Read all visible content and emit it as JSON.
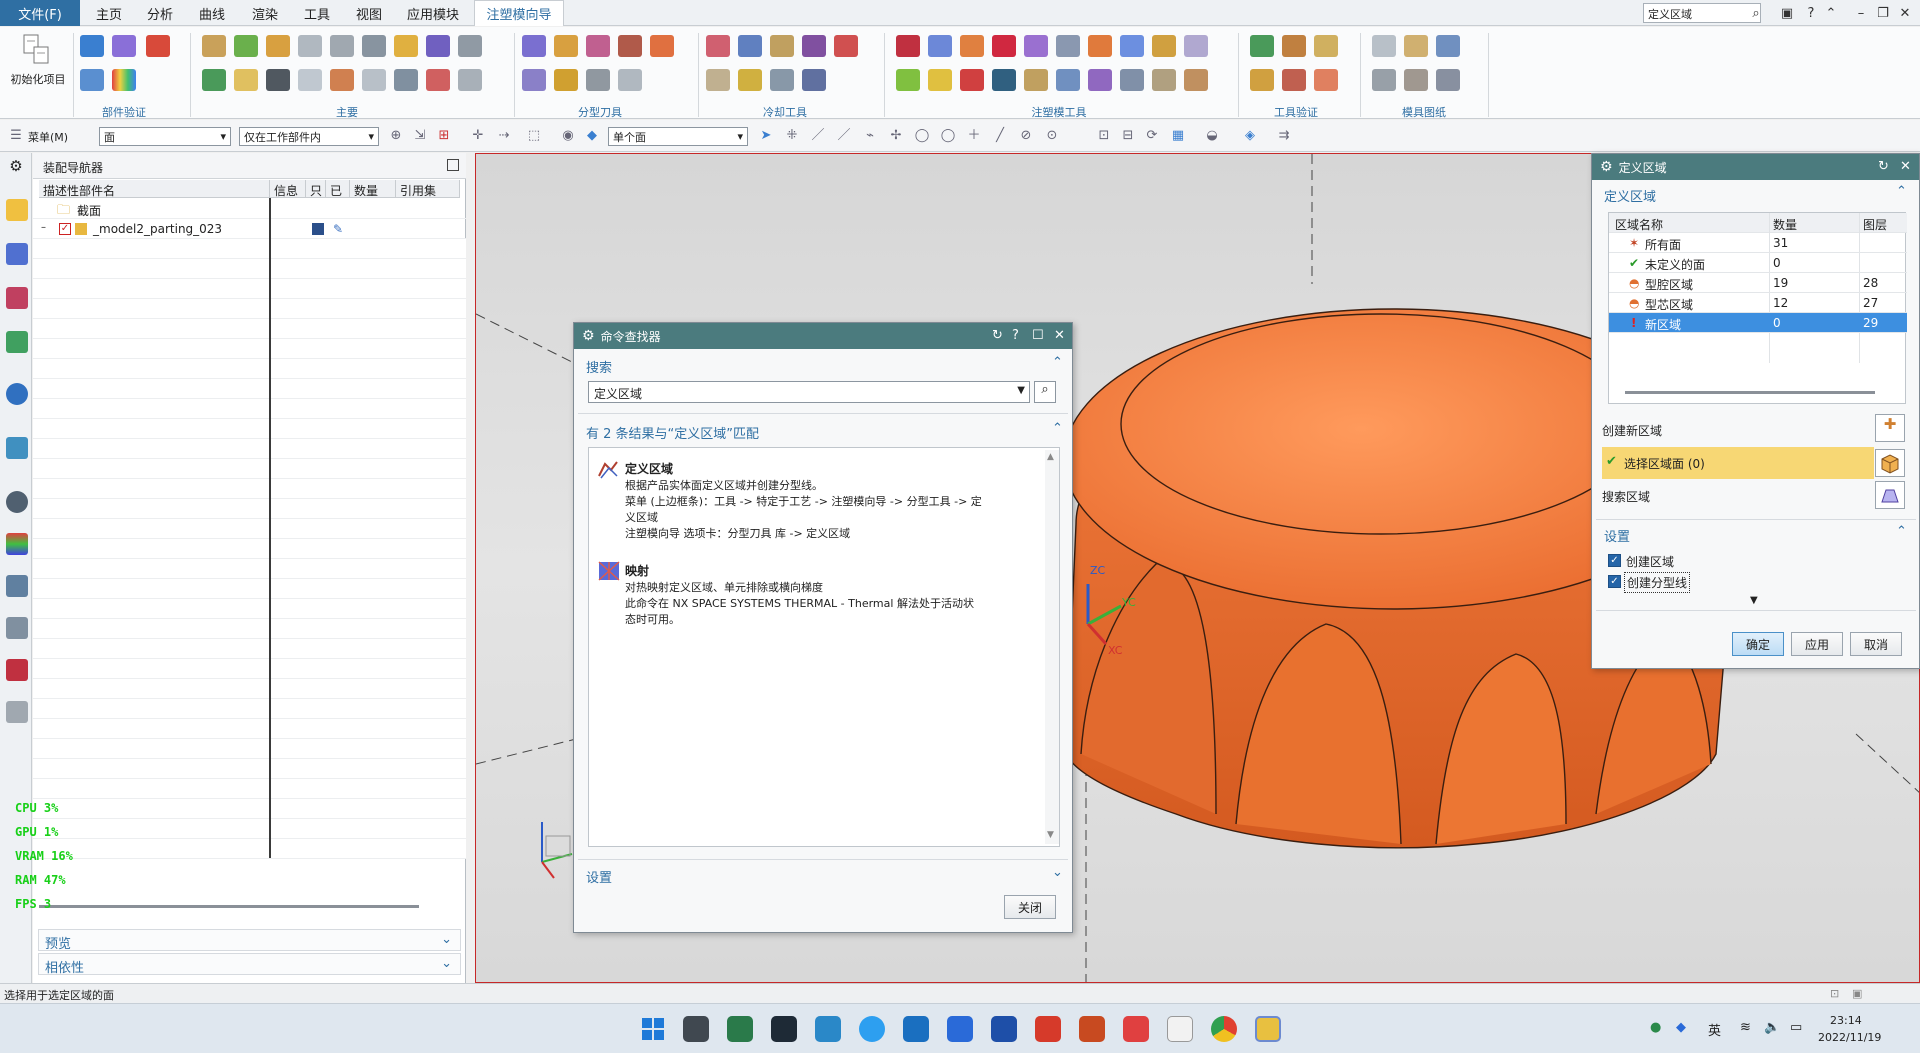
{
  "menubar": {
    "file": "文件(F)",
    "tabs": [
      "主页",
      "分析",
      "曲线",
      "渲染",
      "工具",
      "视图",
      "应用模块",
      "注塑模向导"
    ],
    "active_tab": "注塑模向导",
    "search_value": "定义区域"
  },
  "ribbon": {
    "init_label": "初始化项目",
    "groups": [
      "部件验证",
      "主要",
      "分型刀具",
      "冷却工具",
      "注塑模工具",
      "工具验证",
      "模具图纸"
    ]
  },
  "toolbar2": {
    "menu_label": "菜单(M)",
    "filter_type": "面",
    "filter_scope": "仅在工作部件内",
    "select_mode": "单个面"
  },
  "navigator": {
    "title": "装配导航器",
    "columns": [
      "描述性部件名",
      "信息",
      "只",
      "已",
      "数量",
      "引用集"
    ],
    "rows": [
      {
        "name": "截面"
      },
      {
        "name": "_model2_parting_023"
      }
    ],
    "sections": [
      "预览",
      "相依性"
    ]
  },
  "perf": {
    "cpu": "CPU   3%",
    "gpu": "GPU   1%",
    "vram": "VRAM  16%",
    "ram": "RAM   47%",
    "fps": "FPS    3"
  },
  "command_finder": {
    "title": "命令查找器",
    "search_section": "搜索",
    "search_value": "定义区域",
    "results_header": "有 2 条结果与“定义区域”匹配",
    "results": [
      {
        "title": "定义区域",
        "line1": "根据产品实体面定义区域并创建分型线。",
        "line2": "菜单 (上边框条)：工具 -> 特定于工艺 -> 注塑模向导 -> 分型工具 -> 定",
        "line3": "义区域",
        "line4": "注塑模向导 选项卡：分型刀具 库 -> 定义区域"
      },
      {
        "title": "映射",
        "line1": "对热映射定义区域、单元排除或横向梯度",
        "line2": "此命令在 NX SPACE SYSTEMS THERMAL - Thermal 解法处于活动状",
        "line3": "态时可用。"
      }
    ],
    "settings_section": "设置",
    "close_label": "关闭"
  },
  "define_region": {
    "title": "定义区域",
    "section_title": "定义区域",
    "columns": [
      "区域名称",
      "数量",
      "图层"
    ],
    "rows": [
      {
        "name": "所有面",
        "count": "31",
        "layer": ""
      },
      {
        "name": "未定义的面",
        "count": "0",
        "layer": ""
      },
      {
        "name": "型腔区域",
        "count": "19",
        "layer": "28"
      },
      {
        "name": "型芯区域",
        "count": "12",
        "layer": "27"
      },
      {
        "name": "新区域",
        "count": "0",
        "layer": "29"
      }
    ],
    "create_new_region": "创建新区域",
    "select_region_faces": "选择区域面 (0)",
    "search_region": "搜索区域",
    "settings_title": "设置",
    "opt_create_region": "创建区域",
    "opt_create_parting_line": "创建分型线",
    "ok": "确定",
    "apply": "应用",
    "cancel": "取消"
  },
  "axis": {
    "zc": "ZC",
    "yc": "YC",
    "xc": "XC"
  },
  "statusbar": {
    "text": "选择用于选定区域的面"
  },
  "taskbar": {
    "lang": "英",
    "time": "23:14",
    "date": "2022/11/19"
  },
  "colors": {
    "accent": "#2f6fa3",
    "dialog_title": "#4b7b7e",
    "part_orange": "#f07a3c",
    "selection_blue": "#3d8fe0",
    "highlight_yellow": "#f7d774",
    "perf_green": "#18d018"
  }
}
